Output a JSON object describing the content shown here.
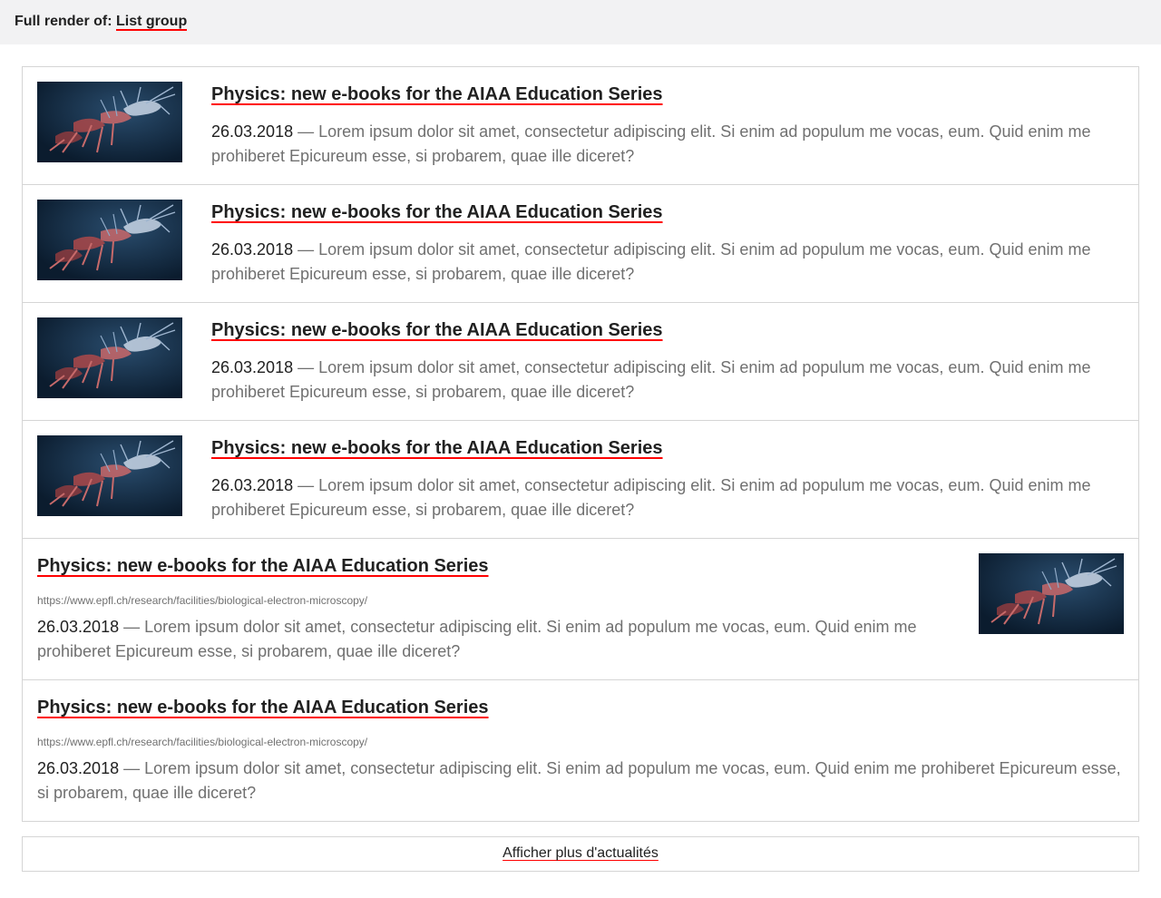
{
  "header": {
    "prefix": "Full render of:",
    "link": "List group"
  },
  "items": [
    {
      "title": "Physics: new e-books for the AIAA Education Series",
      "date": "26.03.2018",
      "text": "Lorem ipsum dolor sit amet, consectetur adipiscing elit. Si enim ad populum me vocas, eum. Quid enim me prohiberet Epicureum esse, si probarem, quae ille diceret?"
    },
    {
      "title": "Physics: new e-books for the AIAA Education Series",
      "date": "26.03.2018",
      "text": "Lorem ipsum dolor sit amet, consectetur adipiscing elit. Si enim ad populum me vocas, eum. Quid enim me prohiberet Epicureum esse, si probarem, quae ille diceret?"
    },
    {
      "title": "Physics: new e-books for the AIAA Education Series",
      "date": "26.03.2018",
      "text": "Lorem ipsum dolor sit amet, consectetur adipiscing elit. Si enim ad populum me vocas, eum. Quid enim me prohiberet Epicureum esse, si probarem, quae ille diceret?"
    },
    {
      "title": "Physics: new e-books for the AIAA Education Series",
      "date": "26.03.2018",
      "text": "Lorem ipsum dolor sit amet, consectetur adipiscing elit. Si enim ad populum me vocas, eum. Quid enim me prohiberet Epicureum esse, si probarem, quae ille diceret?"
    },
    {
      "title": "Physics: new e-books for the AIAA Education Series",
      "url": "https://www.epfl.ch/research/facilities/biological-electron-microscopy/",
      "date": "26.03.2018",
      "text": "Lorem ipsum dolor sit amet, consectetur adipiscing elit. Si enim ad populum me vocas, eum. Quid enim me prohiberet Epicureum esse, si probarem, quae ille diceret?"
    },
    {
      "title": "Physics: new e-books for the AIAA Education Series",
      "url": "https://www.epfl.ch/research/facilities/biological-electron-microscopy/",
      "date": "26.03.2018",
      "text": "Lorem ipsum dolor sit amet, consectetur adipiscing elit. Si enim ad populum me vocas, eum. Quid enim me prohiberet Epicureum esse, si probarem, quae ille diceret?"
    }
  ],
  "separator": " — ",
  "more_label": "Afficher plus d'actualités",
  "colors": {
    "accent": "#ff0000",
    "text": "#212121",
    "muted": "#707070",
    "border": "#d5d5d5",
    "header_bg": "#f2f2f3"
  }
}
